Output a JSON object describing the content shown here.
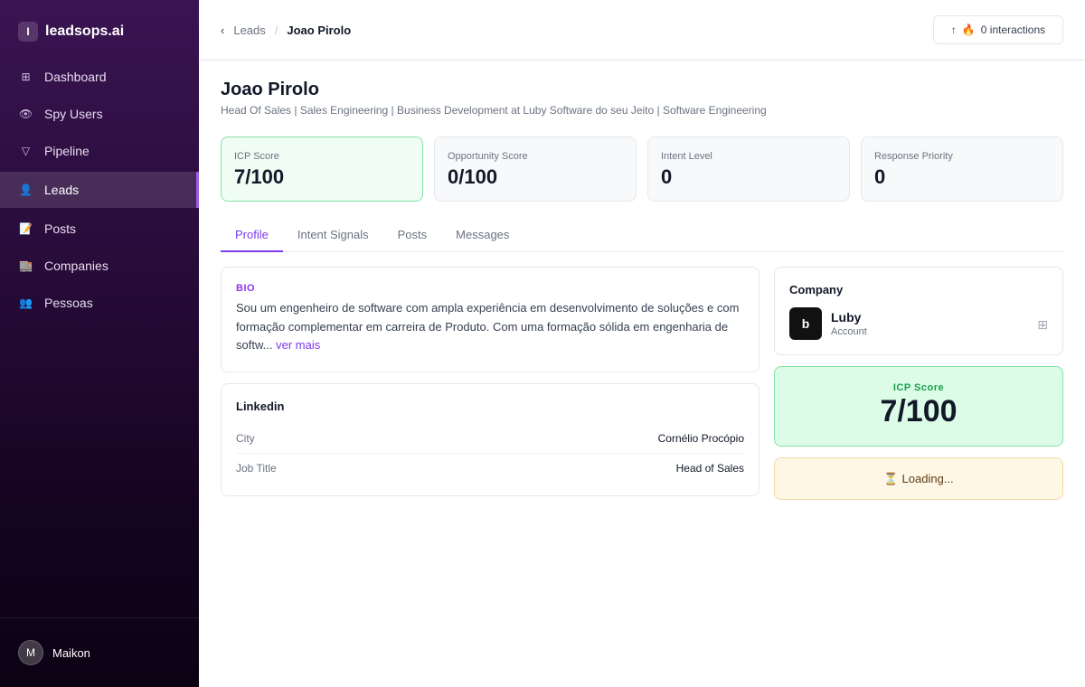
{
  "sidebar": {
    "brand_badge": "I",
    "brand_name": "leadsops.ai",
    "items": [
      {
        "label": "Dashboard",
        "icon": "⊞"
      },
      {
        "label": "Spy Users",
        "icon": "👁"
      },
      {
        "label": "Pipeline",
        "icon": "▽"
      },
      {
        "label": "Leads",
        "icon": "👤"
      },
      {
        "label": "Posts",
        "icon": "📝"
      },
      {
        "label": "Companies",
        "icon": "🏬"
      },
      {
        "label": "Pessoas",
        "icon": "👥"
      }
    ],
    "active_item": "Leads",
    "user": {
      "initial": "M",
      "name": "Maikon"
    }
  },
  "header": {
    "back_icon": "‹",
    "breadcrumb_parent": "Leads",
    "breadcrumb_sep": "/",
    "breadcrumb_current": "Joao Pirolo",
    "interactions": {
      "arrow": "↑",
      "fire": "🔥",
      "label": "0 interactions"
    }
  },
  "lead": {
    "name": "Joao Pirolo",
    "headline": "Head Of Sales | Sales Engineering | Business Development at Luby Software do seu Jeito | Software Engineering"
  },
  "stats": [
    {
      "label": "ICP Score",
      "value": "7/100"
    },
    {
      "label": "Opportunity Score",
      "value": "0/100"
    },
    {
      "label": "Intent Level",
      "value": "0"
    },
    {
      "label": "Response Priority",
      "value": "0"
    }
  ],
  "tabs": [
    {
      "label": "Profile"
    },
    {
      "label": "Intent Signals"
    },
    {
      "label": "Posts"
    },
    {
      "label": "Messages"
    }
  ],
  "active_tab": "Profile",
  "bio": {
    "title": "BIO",
    "text": "Sou um engenheiro de software com ampla experiência em desenvolvimento de soluções e com formação complementar em carreira de Produto. Com uma formação sólida em engenharia de softw...",
    "more": "ver mais"
  },
  "linkedin": {
    "title": "Linkedin",
    "rows": [
      {
        "key": "City",
        "value": "Cornélio Procópio"
      },
      {
        "key": "Job Title",
        "value": "Head of Sales"
      }
    ]
  },
  "company": {
    "title": "Company",
    "logo_letter": "b",
    "name": "Luby",
    "subtitle": "Account",
    "action_icon": "⊞"
  },
  "icp_card": {
    "label": "ICP Score",
    "value": "7/100"
  },
  "loading": {
    "icon": "⏳",
    "text": "Loading..."
  },
  "colors": {
    "accent": "#7c3aed",
    "success": "#16a34a",
    "success_bg": "#dcfce7",
    "warning_bg": "#fff7e6"
  }
}
